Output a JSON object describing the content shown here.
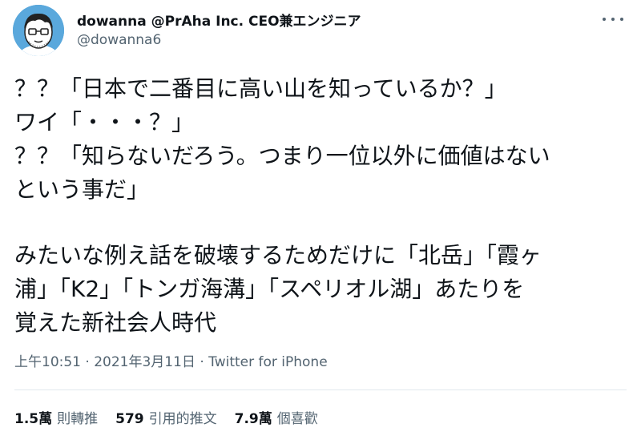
{
  "author": {
    "display_name": "dowanna @PrAha Inc. CEO兼エンジニア",
    "handle": "@dowanna6",
    "avatar_icon": "user-avatar-icon"
  },
  "tweet": {
    "lines": [
      "？？「日本で二番目に高い山を知っているか？」",
      "ワイ「・・・？」",
      "？？「知らないだろう。つまり一位以外に価値はない",
      "という事だ」",
      "みたいな例え話を破壊するためだけに「北岳」「霞ヶ",
      "浦」「K2」「トンガ海溝」「スペリオル湖」あたりを",
      "覚えた新社会人時代"
    ]
  },
  "meta": {
    "text": "上午10:51 · 2021年3月11日 · Twitter for iPhone"
  },
  "stats": {
    "retweets_count": "1.5萬",
    "retweets_label": "則轉推",
    "quotes_count": "579",
    "quotes_label": "引用的推文",
    "likes_count": "7.9萬",
    "likes_label": "個喜歡"
  },
  "icons": {
    "more": "more-options-icon"
  }
}
